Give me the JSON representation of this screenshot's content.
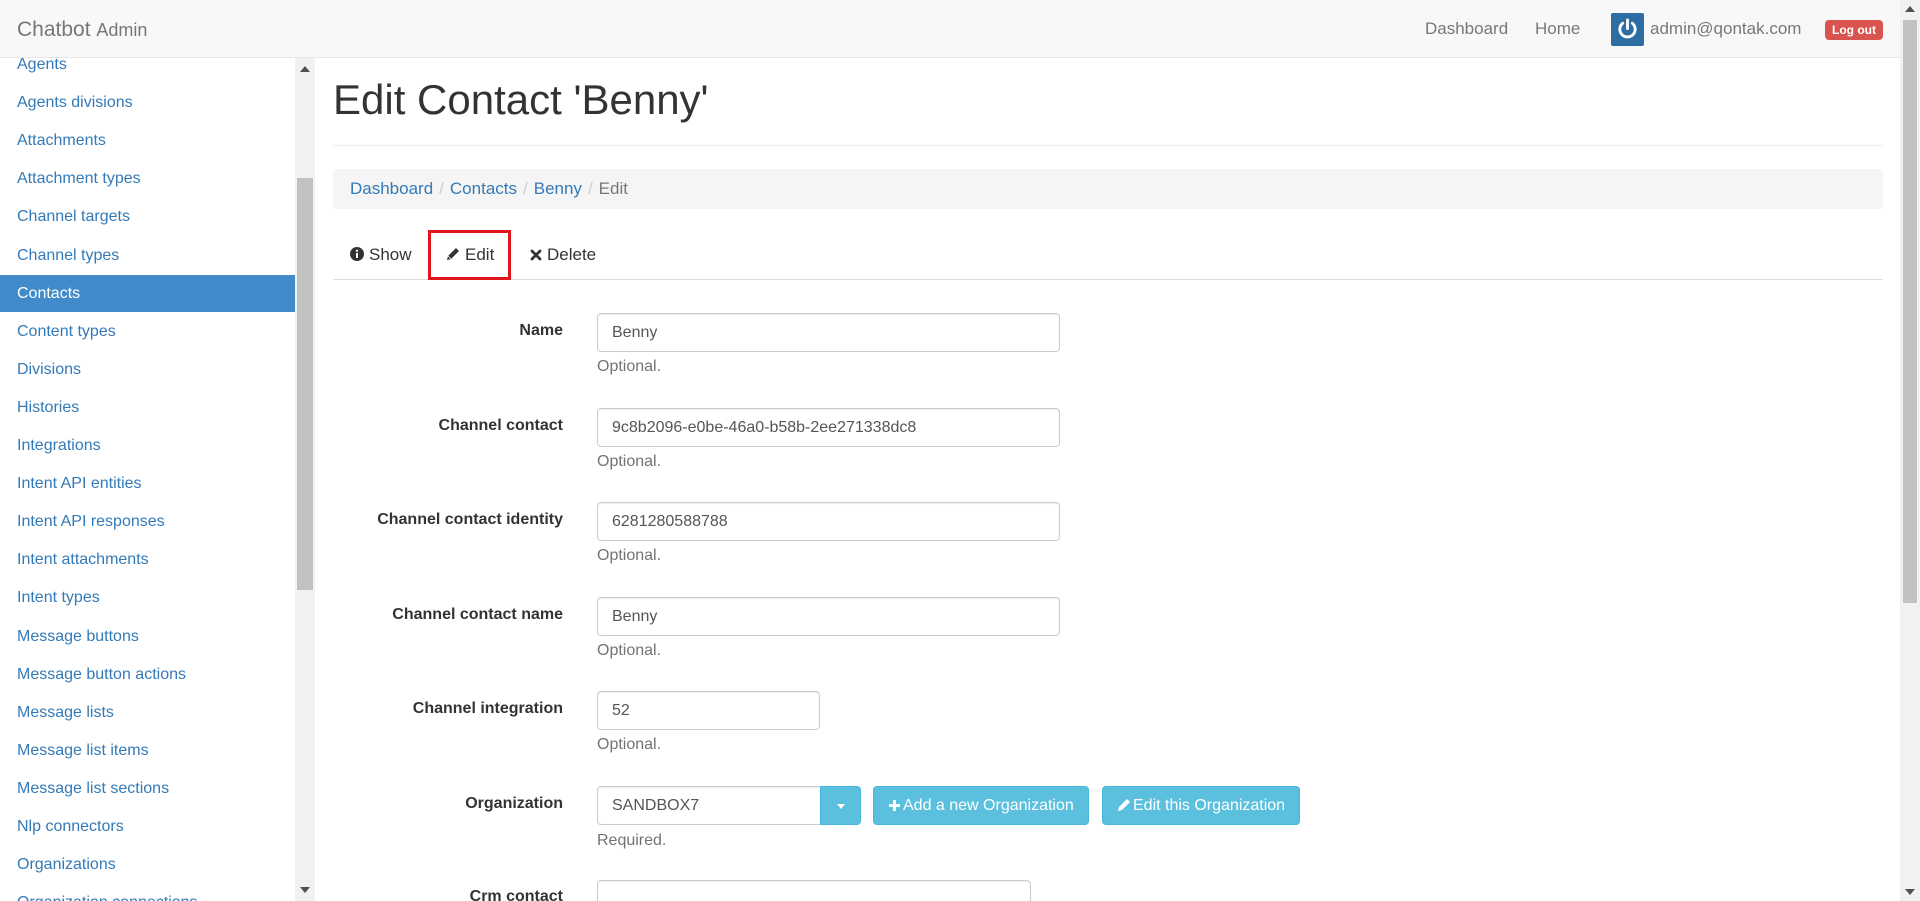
{
  "navbar": {
    "brand": "Chatbot",
    "brand_sub": "Admin",
    "links": [
      "Dashboard",
      "Home"
    ],
    "user_email": "admin@qontak.com",
    "logout_label": "Log out"
  },
  "sidebar": {
    "items": [
      {
        "label": "Agents",
        "active": false
      },
      {
        "label": "Agents divisions",
        "active": false
      },
      {
        "label": "Attachments",
        "active": false
      },
      {
        "label": "Attachment types",
        "active": false
      },
      {
        "label": "Channel targets",
        "active": false
      },
      {
        "label": "Channel types",
        "active": false
      },
      {
        "label": "Contacts",
        "active": true
      },
      {
        "label": "Content types",
        "active": false
      },
      {
        "label": "Divisions",
        "active": false
      },
      {
        "label": "Histories",
        "active": false
      },
      {
        "label": "Integrations",
        "active": false
      },
      {
        "label": "Intent API entities",
        "active": false
      },
      {
        "label": "Intent API responses",
        "active": false
      },
      {
        "label": "Intent attachments",
        "active": false
      },
      {
        "label": "Intent types",
        "active": false
      },
      {
        "label": "Message buttons",
        "active": false
      },
      {
        "label": "Message button actions",
        "active": false
      },
      {
        "label": "Message lists",
        "active": false
      },
      {
        "label": "Message list items",
        "active": false
      },
      {
        "label": "Message list sections",
        "active": false
      },
      {
        "label": "Nlp connectors",
        "active": false
      },
      {
        "label": "Organizations",
        "active": false
      },
      {
        "label": "Organization connections",
        "active": false
      }
    ]
  },
  "page": {
    "title": "Edit Contact 'Benny'",
    "breadcrumb": [
      "Dashboard",
      "Contacts",
      "Benny"
    ],
    "breadcrumb_current": "Edit",
    "tabs": {
      "show": "Show",
      "edit": "Edit",
      "delete": "Delete"
    }
  },
  "form": {
    "name": {
      "label": "Name",
      "value": "Benny",
      "help": "Optional."
    },
    "channel_contact": {
      "label": "Channel contact",
      "value": "9c8b2096-e0be-46a0-b58b-2ee271338dc8",
      "help": "Optional."
    },
    "channel_contact_identity": {
      "label": "Channel contact identity",
      "value": "6281280588788",
      "help": "Optional."
    },
    "channel_contact_name": {
      "label": "Channel contact name",
      "value": "Benny",
      "help": "Optional."
    },
    "channel_integration": {
      "label": "Channel integration",
      "value": "52",
      "help": "Optional."
    },
    "organization": {
      "label": "Organization",
      "value": "SANDBOX7",
      "help": "Required.",
      "add_button": "Add a new Organization",
      "edit_button": "Edit this Organization"
    },
    "crm_contact": {
      "label": "Crm contact",
      "value": ""
    }
  },
  "colors": {
    "accent": "#428bca",
    "link": "#337ab7",
    "info": "#5bc0de",
    "danger": "#d9534f",
    "highlight_box": "#e0161e"
  }
}
